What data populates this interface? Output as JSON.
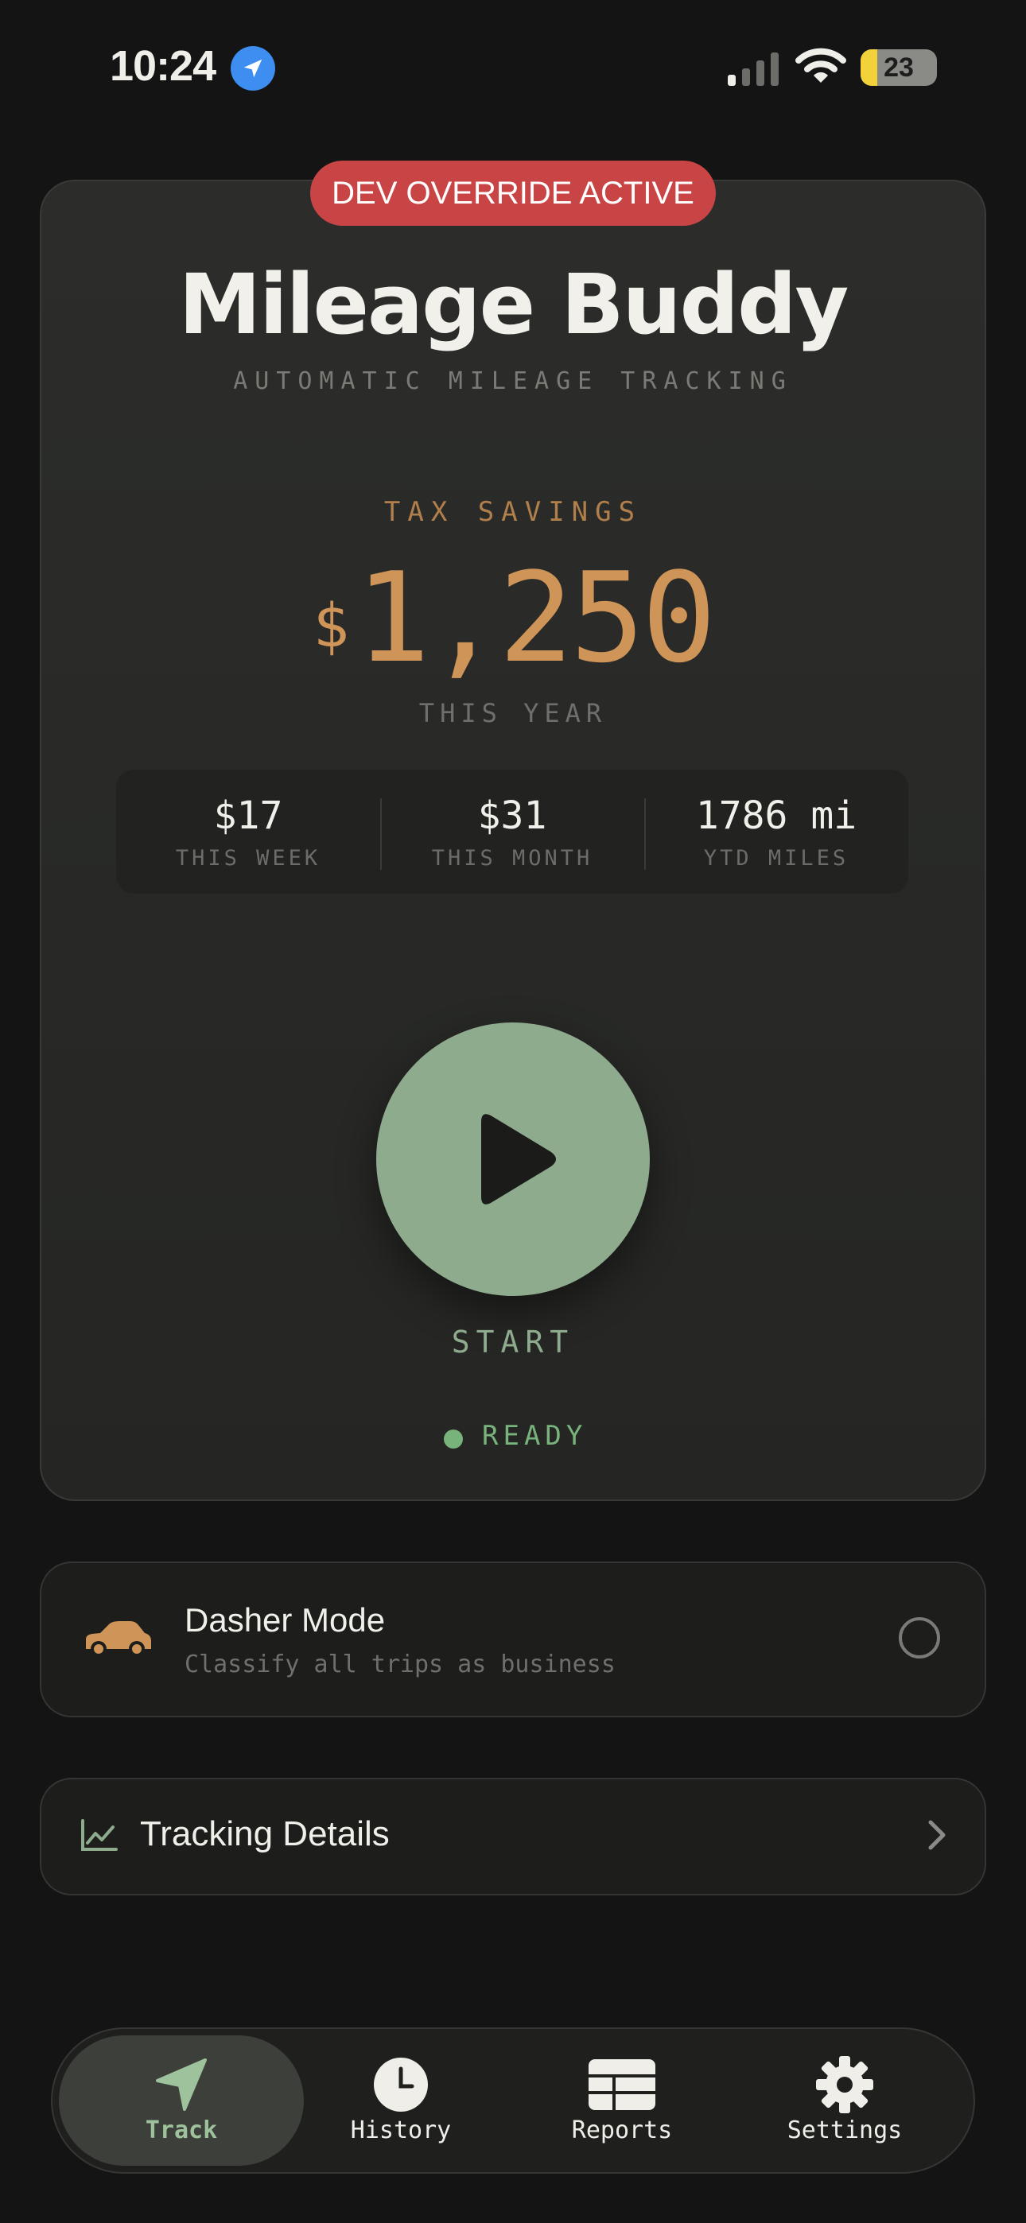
{
  "status_bar": {
    "time": "10:24",
    "battery": "23"
  },
  "badge": {
    "label": "DEV OVERRIDE ACTIVE"
  },
  "header": {
    "title": "Mileage Buddy",
    "subtitle": "AUTOMATIC MILEAGE TRACKING"
  },
  "savings": {
    "label": "TAX SAVINGS",
    "currency": "$",
    "amount": "1,250",
    "period": "THIS YEAR"
  },
  "stats": [
    {
      "value": "$17",
      "label": "THIS WEEK"
    },
    {
      "value": "$31",
      "label": "THIS MONTH"
    },
    {
      "value": "1786 mi",
      "label": "YTD MILES"
    }
  ],
  "tracking": {
    "start_label": "START",
    "status": "READY"
  },
  "dasher": {
    "title": "Dasher Mode",
    "subtitle": "Classify all trips as business"
  },
  "details": {
    "title": "Tracking Details"
  },
  "tabs": [
    {
      "label": "Track",
      "icon": "navigation-arrow-icon",
      "active": true
    },
    {
      "label": "History",
      "icon": "clock-icon"
    },
    {
      "label": "Reports",
      "icon": "table-icon"
    },
    {
      "label": "Settings",
      "icon": "gear-icon"
    }
  ],
  "colors": {
    "background": "#131413",
    "accent_gold": "#cf9458",
    "accent_green": "#8eab8e",
    "badge_red": "#c94545",
    "ready_green": "#78b37c"
  }
}
